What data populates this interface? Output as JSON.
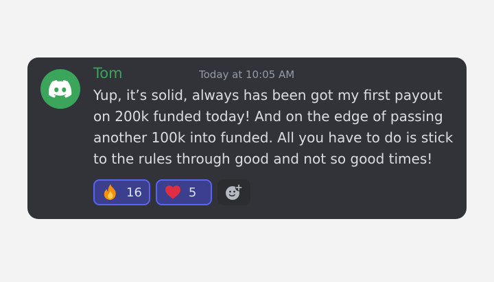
{
  "message": {
    "username": "Tom",
    "timestamp": "Today at 10:05 AM",
    "body": "Yup, it’s solid, always has been got my first payout on 200k funded today! And on the edge of passing another 100k into funded. All you have to do is stick to the rules through good and not  so good times!",
    "avatar_icon": "discord-logo-icon",
    "username_color": "#3ba55c"
  },
  "reactions": [
    {
      "emoji_icon": "fire-icon",
      "count": "16"
    },
    {
      "emoji_icon": "heart-icon",
      "count": "5"
    }
  ],
  "add_reaction_icon": "add-reaction-icon",
  "colors": {
    "card_bg": "#313338",
    "reaction_bg": "#3b3f8d",
    "reaction_border": "#5865f2",
    "text": "#dbdee1",
    "muted": "#949ba4"
  }
}
